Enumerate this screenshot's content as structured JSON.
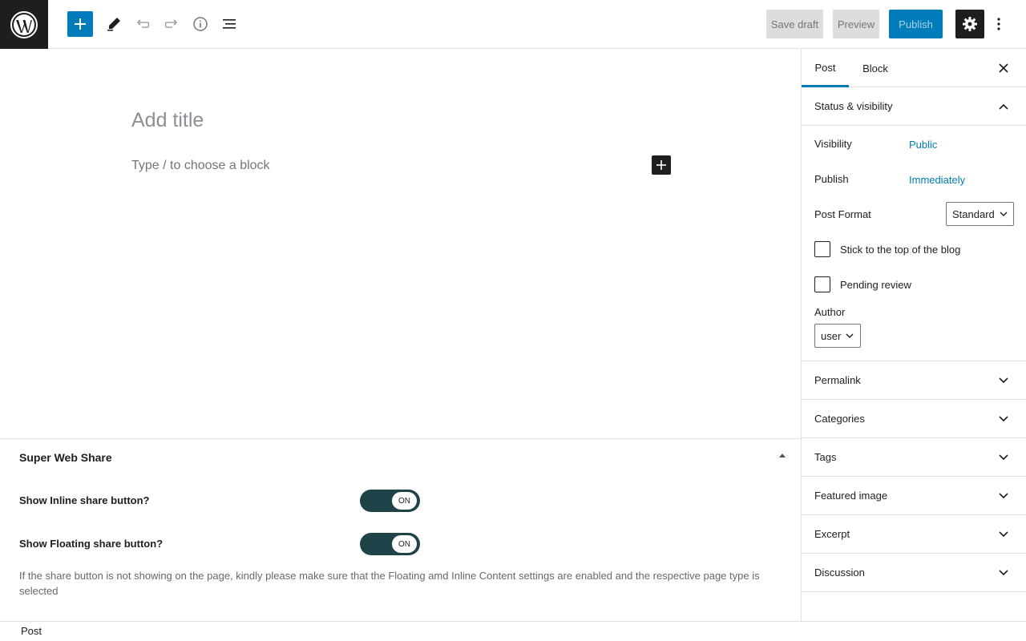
{
  "toolbar": {
    "save_draft": "Save draft",
    "preview": "Preview",
    "publish": "Publish"
  },
  "editor": {
    "title_placeholder": "Add title",
    "block_placeholder": "Type / to choose a block"
  },
  "metabox": {
    "title": "Super Web Share",
    "rows": [
      {
        "label": "Show Inline share button?",
        "toggle": "ON"
      },
      {
        "label": "Show Floating share button?",
        "toggle": "ON"
      }
    ],
    "note": "If the share button is not showing on the page, kindly please make sure that the Floating amd Inline Content settings are enabled and the respective page type is selected"
  },
  "footer": {
    "breadcrumb": "Post"
  },
  "sidebar": {
    "tabs": [
      "Post",
      "Block"
    ],
    "status_panel": {
      "title": "Status & visibility",
      "visibility_label": "Visibility",
      "visibility_value": "Public",
      "publish_label": "Publish",
      "publish_value": "Immediately",
      "format_label": "Post Format",
      "format_value": "Standard",
      "sticky_label": "Stick to the top of the blog",
      "pending_label": "Pending review",
      "author_label": "Author",
      "author_value": "user"
    },
    "panels": [
      "Permalink",
      "Categories",
      "Tags",
      "Featured image",
      "Excerpt",
      "Discussion"
    ]
  },
  "colors": {
    "accent": "#007cba",
    "toggle_bg": "#1f4348",
    "dark": "#1e1e1e"
  }
}
